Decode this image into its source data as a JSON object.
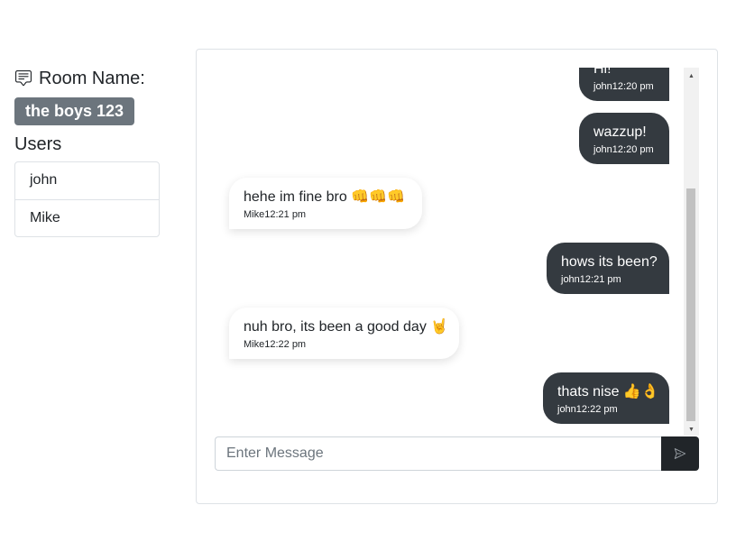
{
  "sidebar": {
    "room_label": "Room Name:",
    "room_name": "the boys 123",
    "users_heading": "Users",
    "users": [
      {
        "name": "john"
      },
      {
        "name": "Mike"
      }
    ]
  },
  "messages": [
    {
      "direction": "sent",
      "text": "Hi!",
      "author": "john",
      "time": "12:20 pm"
    },
    {
      "direction": "sent",
      "text": "wazzup!",
      "author": "john",
      "time": "12:20 pm"
    },
    {
      "direction": "received",
      "text": "hehe im fine bro 👊👊👊",
      "author": "Mike",
      "time": "12:21 pm"
    },
    {
      "direction": "sent",
      "text": "hows its been?",
      "author": "john",
      "time": "12:21 pm"
    },
    {
      "direction": "received",
      "text": "nuh bro, its been a good day 🤘",
      "author": "Mike",
      "time": "12:22 pm"
    },
    {
      "direction": "sent",
      "text": "thats nise 👍👌",
      "author": "john",
      "time": "12:22 pm"
    }
  ],
  "composer": {
    "placeholder": "Enter Message"
  },
  "colors": {
    "sent_bubble": "#343a40",
    "received_bubble": "#ffffff",
    "room_badge": "#6c757d",
    "send_button": "#212529"
  },
  "icons": {
    "room": "chat-square-text-icon",
    "send": "send-icon"
  }
}
